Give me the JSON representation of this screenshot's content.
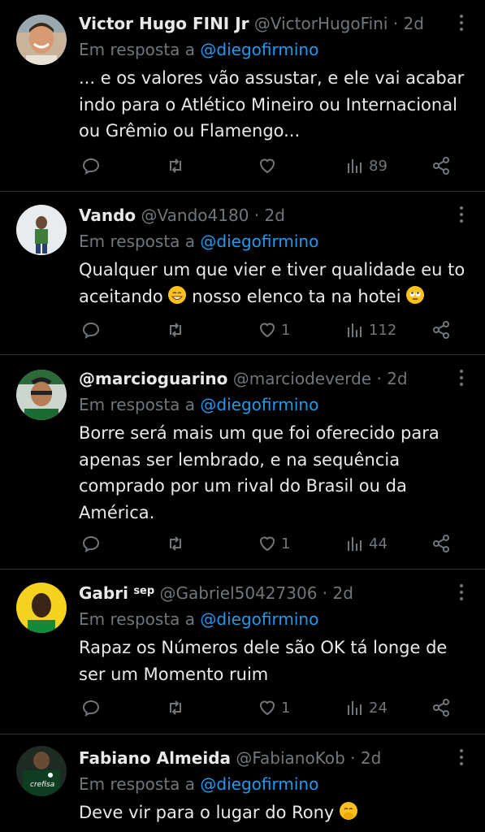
{
  "reply_prefix": "Em resposta a",
  "tweets": [
    {
      "name": "Victor Hugo FINI Jr",
      "sup": "",
      "handle": "@VictorHugoFini",
      "time": "2d",
      "reply_to": "@diegofirmino",
      "text": "... e os valores vão assustar, e ele vai acabar indo para o Atlético Mineiro ou Internacional ou Grêmio ou Flamengo...",
      "likes": "",
      "views": "89"
    },
    {
      "name": "Vando",
      "sup": "",
      "handle": "@Vando4180",
      "time": "2d",
      "reply_to": "@diegofirmino",
      "text_parts": [
        "Qualquer um que vier e tiver qualidade eu to aceitando",
        "nosso elenco ta na hotei"
      ],
      "likes": "1",
      "views": "112"
    },
    {
      "name": "@marcioguarino",
      "sup": "",
      "handle": "@marciodeverde",
      "time": "2d",
      "reply_to": "@diegofirmino",
      "text": "Borre será mais um que foi oferecido para apenas ser lembrado, e na sequência comprado por um rival do Brasil ou da América.",
      "likes": "1",
      "views": "44"
    },
    {
      "name": "Gabri",
      "sup": "sep",
      "handle": "@Gabriel50427306",
      "time": "2d",
      "reply_to": "@diegofirmino",
      "text": "Rapaz os Números dele são OK tá longe de ser um Momento ruim",
      "likes": "1",
      "views": "24"
    },
    {
      "name": "Fabiano Almeida",
      "sup": "",
      "handle": "@FabianoKob",
      "time": "2d",
      "reply_to": "@diegofirmino",
      "text": "Deve vir para o lugar do Rony",
      "avatar_text": "crefisa"
    }
  ],
  "colors": {
    "muted": "#71767b",
    "link": "#1d9bf0",
    "text": "#e7e9ea",
    "divider": "#2f3336"
  }
}
